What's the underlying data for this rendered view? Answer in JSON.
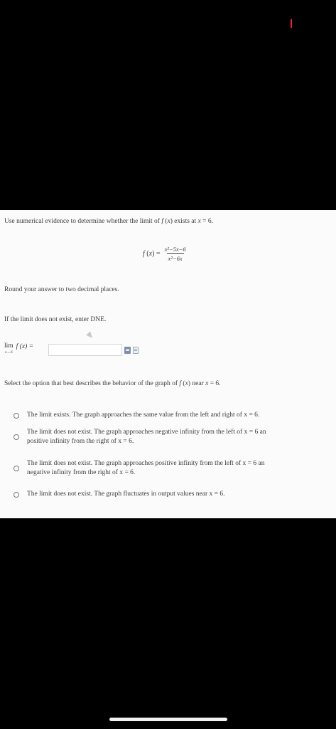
{
  "question": {
    "prompt": "Use numerical evidence to determine whether the limit of",
    "fn": "f",
    "var": "x",
    "exists_at": "exists at",
    "eq": "= 6.",
    "formula": {
      "lhs_fn": "f",
      "lhs_var": "x",
      "numerator": "x²−5x−6",
      "denominator": "x²−6x"
    },
    "round_instruction": "Round your answer to two decimal places.",
    "dne_instruction": "If the limit does not exist, enter DNE."
  },
  "answer": {
    "lim_label": "lim",
    "lim_sub": "x→6",
    "lim_expr": "f (x) =",
    "value": ""
  },
  "behavior": {
    "prompt_start": "Select the option that best describes the behavior of the graph of",
    "prompt_near": "near",
    "prompt_end": "= 6.",
    "options": [
      {
        "line1": "The limit exists. The graph approaches the same value from the left and right of x = 6.",
        "line2": ""
      },
      {
        "line1": "The limit does not exist. The graph approaches negative infinity from the left of x = 6 an",
        "line2": "positive infinity from the right of x = 6."
      },
      {
        "line1": "The limit does not exist. The graph approaches positive infinity from the left of x = 6 an",
        "line2": "negative infinity from the right of x = 6."
      },
      {
        "line1": "The limit does not exist. The graph fluctuates in output values near x = 6.",
        "line2": ""
      }
    ]
  },
  "colors": {
    "background": "#000000",
    "content": "#fbfbfb",
    "text": "#3a3a3a",
    "status_mark": "#e8262c"
  }
}
